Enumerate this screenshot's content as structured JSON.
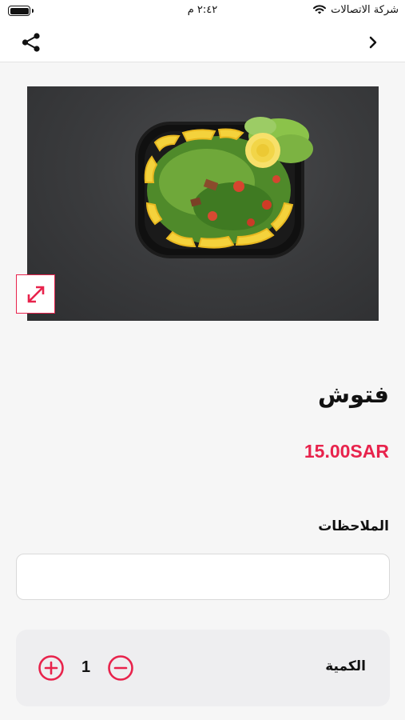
{
  "status_bar": {
    "carrier": "شركة الاتصالات",
    "time": "٢:٤٢ م",
    "icons": [
      "battery-icon",
      "wifi-icon"
    ]
  },
  "nav": {
    "icons": [
      "share-icon",
      "back-chevron-icon"
    ]
  },
  "product": {
    "name": "فتوش",
    "price": "15.00SAR",
    "image_alt": "fattoush-salad-image"
  },
  "notes": {
    "label": "الملاحظات",
    "value": "",
    "placeholder": ""
  },
  "quantity": {
    "label": "الكمية",
    "value": "1",
    "icons": [
      "plus-circle-icon",
      "minus-circle-icon"
    ]
  },
  "colors": {
    "accent": "#e8234c",
    "background": "#f6f6f6",
    "panel": "#eeeef0"
  }
}
